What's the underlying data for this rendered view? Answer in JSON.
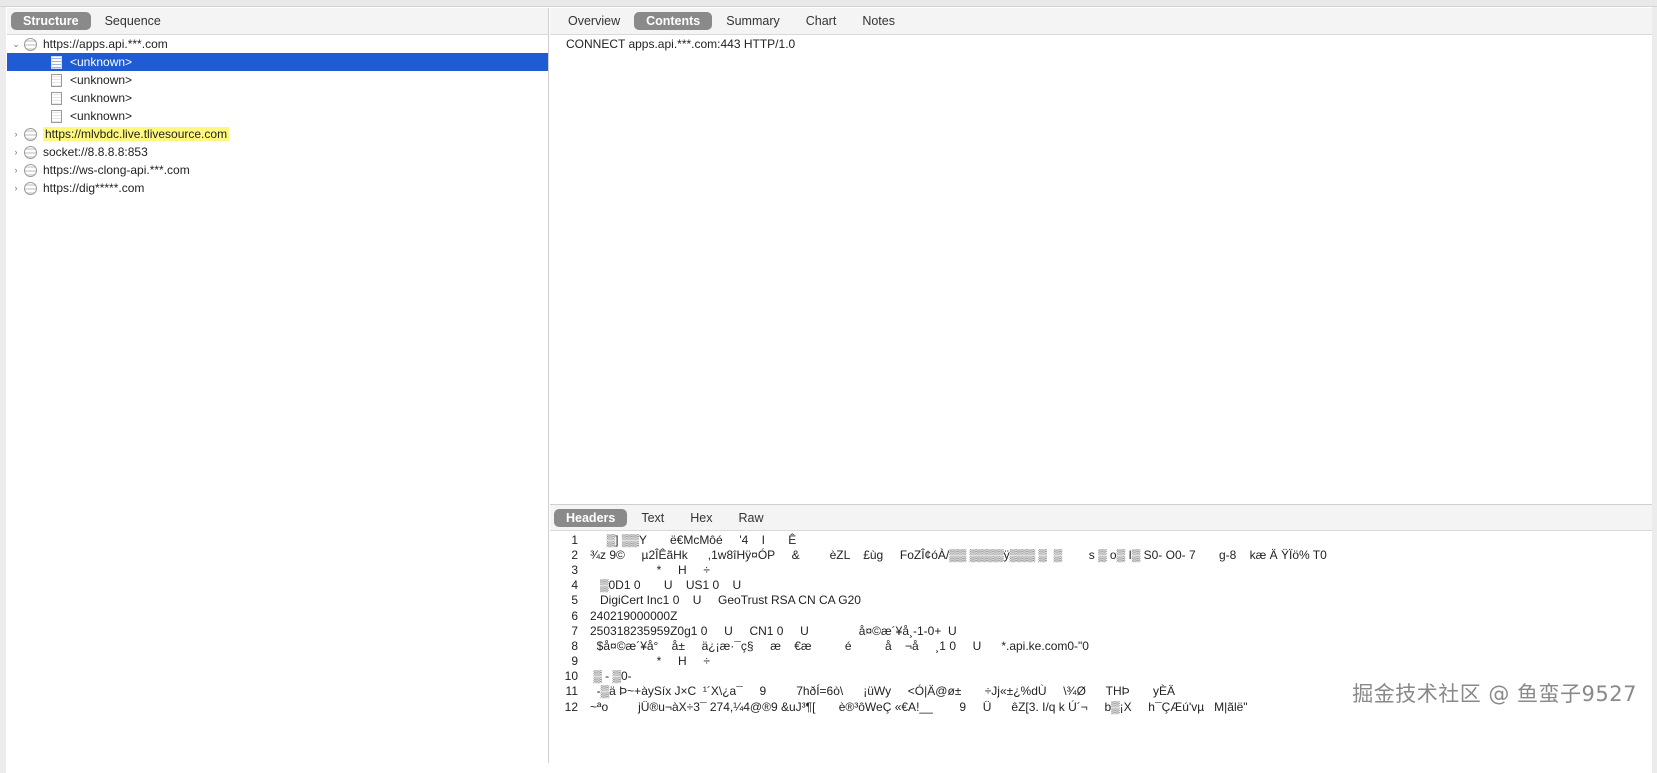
{
  "left": {
    "segments": [
      "Structure",
      "Sequence"
    ],
    "tree": [
      {
        "kind": "host",
        "expanded": true,
        "label": "https://apps.api.***.com"
      },
      {
        "kind": "child",
        "label": "<unknown>",
        "selected": true
      },
      {
        "kind": "child",
        "label": "<unknown>"
      },
      {
        "kind": "child",
        "label": "<unknown>"
      },
      {
        "kind": "child",
        "label": "<unknown>"
      },
      {
        "kind": "host",
        "expanded": false,
        "label": "https://mlvbdc.live.tlivesource.com",
        "highlight": true
      },
      {
        "kind": "host",
        "expanded": false,
        "label": "socket://8.8.8.8:853"
      },
      {
        "kind": "host",
        "expanded": false,
        "label": "https://ws-clong-api.***.com"
      },
      {
        "kind": "host",
        "expanded": false,
        "label": "https://dig*****.com"
      }
    ]
  },
  "right": {
    "tabs": [
      "Overview",
      "Contents",
      "Summary",
      "Chart",
      "Notes"
    ],
    "active_tab": "Contents",
    "request_line": "CONNECT apps.api.***.com:443 HTTP/1.0",
    "sub_tabs": [
      "Headers",
      "Text",
      "Hex",
      "Raw"
    ],
    "active_sub_tab": "Headers",
    "lines": [
      {
        "n": "1",
        "text": "     ▒] ▒▒Y       ë€McMôé     '4    I       Ê"
      },
      {
        "n": "2",
        "text": "¾z 9©     µ2ÎÊãHk      ,1w8îHÿ¤ÓP     &         èZL    £ùg     FoZÎ¢óÀ/▒▒ ▒▒▒▒ÿ▒▒▒ ▒  ▒        s ▒ o▒ I▒ S0- O0- 7       g-8    kæ Ä ŸÏö% T0"
      },
      {
        "n": "3",
        "text": "                    *     H     ÷"
      },
      {
        "n": "4",
        "text": "   ▒0D1 0       U    US1 0    U"
      },
      {
        "n": "5",
        "text": "   DigiCert Inc1 0    U     GeoTrust RSA CN CA G20"
      },
      {
        "n": "6",
        "text": "240219000000Z"
      },
      {
        "n": "7",
        "text": "250318235959Z0g1 0     U     CN1 0     U               å¤©æ´¥å¸-1-0+  U"
      },
      {
        "n": "8",
        "text": "  $å¤©æ´¥å°    å±     ä¿¡æ·¯ç§     æ    €æ          é          å    ¬å     ¸1 0     U      *.api.ke.com0-\"0"
      },
      {
        "n": "9",
        "text": "                    *     H     ÷"
      },
      {
        "n": "10",
        "text": " ▒ - ▒0-"
      },
      {
        "n": "11",
        "text": "  -▒ä Þ~+àySíx J×C  ¹´X\\¿a¯     9         7hðÍ=6ò\\      ¡üWy     <Ó|Ä@ø±       ÷Jj«±¿%dÙ     \\¾Ø      THÞ       yÈÄ"
      },
      {
        "n": "12",
        "text": "~ªo         jÜ®u¬àX÷3¯ 274,¼4@®9 &uJ³¶[       è®³ôWeÇ «€A!__        9     Ü      êZ[3. I/q k Ú´¬     b▒¡X     h¯ÇÆú'vµ   M|ãlë\""
      }
    ],
    "watermark": "掘金技术社区 @ 鱼蛮子9527"
  }
}
